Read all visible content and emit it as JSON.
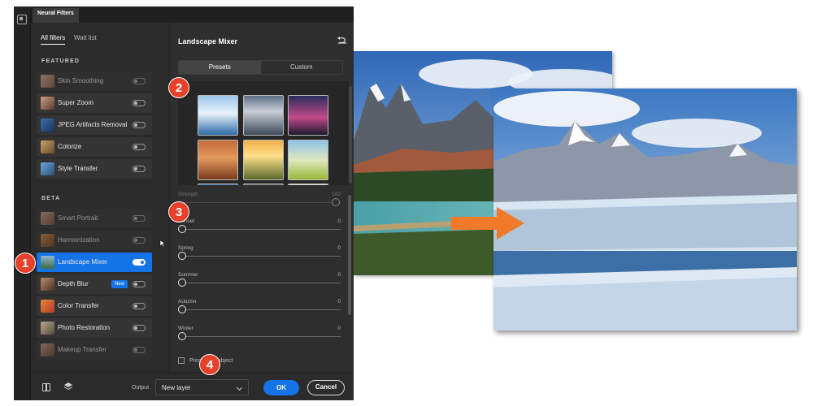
{
  "window": {
    "tab_title": "Neural Filters"
  },
  "nav": {
    "all_filters": "All filters",
    "wait_list": "Wait list"
  },
  "sections": {
    "featured": "FEATURED",
    "beta": "BETA"
  },
  "filters": {
    "skin_smoothing": "Skin Smoothing",
    "super_zoom": "Super Zoom",
    "jpeg_artifacts": "JPEG Artifacts Removal",
    "colorize": "Colorize",
    "style_transfer": "Style Transfer",
    "smart_portrait": "Smart Portrait",
    "harmonization": "Harmonization",
    "landscape_mixer": "Landscape Mixer",
    "depth_blur": "Depth Blur",
    "depth_blur_badge": "New",
    "color_transfer": "Color Transfer",
    "photo_restoration": "Photo Restoration",
    "makeup_transfer": "Makeup Transfer"
  },
  "panel": {
    "title": "Landscape Mixer",
    "tab_presets": "Presets",
    "tab_custom": "Custom"
  },
  "sliders": {
    "strength": {
      "label": "Strength",
      "value": "100"
    },
    "sunset": {
      "label": "Sunset",
      "value": "0"
    },
    "spring": {
      "label": "Spring",
      "value": "0"
    },
    "summer": {
      "label": "Summer",
      "value": "0"
    },
    "autumn": {
      "label": "Autumn",
      "value": "0"
    },
    "winter": {
      "label": "Winter",
      "value": "0"
    }
  },
  "preserve_subject": "Preserve Subject",
  "bottom": {
    "output_label": "Output",
    "output_value": "New layer",
    "ok": "OK",
    "cancel": "Cancel"
  },
  "markers": {
    "m1": "1",
    "m2": "2",
    "m3": "3",
    "m4": "4"
  },
  "colors": {
    "accent": "#1473e6",
    "marker": "#e8412b",
    "arrow": "#f07a2a"
  }
}
